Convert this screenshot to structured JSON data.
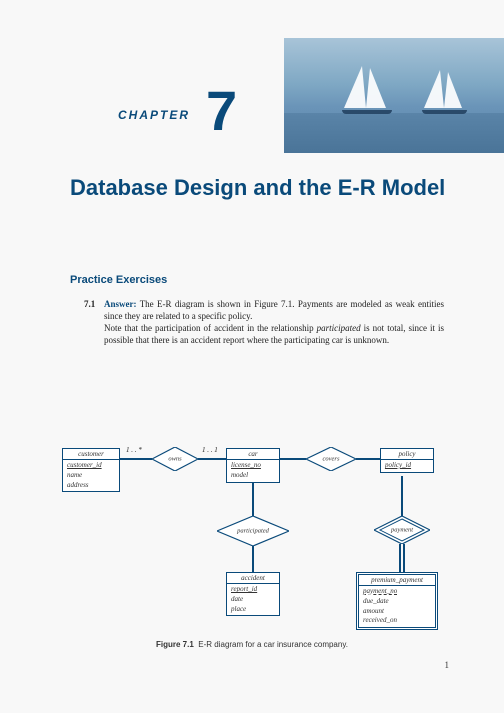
{
  "chapter": {
    "label": "CHAPTER",
    "number": "7",
    "title": "Database Design and the E-R Model"
  },
  "section": "Practice Exercises",
  "exercise": {
    "number": "7.1",
    "answer_label": "Answer:",
    "text1": "The E-R diagram is shown in Figure 7.1. Payments are modeled as weak entities since they are related to a specific policy.",
    "text2": "Note that the participation of accident in the relationship",
    "text2b": "participated",
    "text2c": " is not total, since it is possible that there is an accident report where the participating car is unknown."
  },
  "er": {
    "customer": {
      "name": "customer",
      "attrs": [
        "customer_id",
        "name",
        "address"
      ]
    },
    "car": {
      "name": "car",
      "attrs": [
        "license_no",
        "model"
      ]
    },
    "policy": {
      "name": "policy",
      "attrs": [
        "policy_id"
      ]
    },
    "accident": {
      "name": "accident",
      "attrs": [
        "report_id",
        "date",
        "place"
      ]
    },
    "premium_payment": {
      "name": "premium_payment",
      "attrs": [
        "payment_no",
        "due_date",
        "amount",
        "received_on"
      ]
    },
    "owns": "owns",
    "covers": "covers",
    "participated": "participated",
    "payment": "payment",
    "card1": "1 . . *",
    "card2": "1 . . 1"
  },
  "figure": {
    "label": "Figure 7.1",
    "caption": "E-R diagram for a car insurance company."
  },
  "page_number": "1"
}
